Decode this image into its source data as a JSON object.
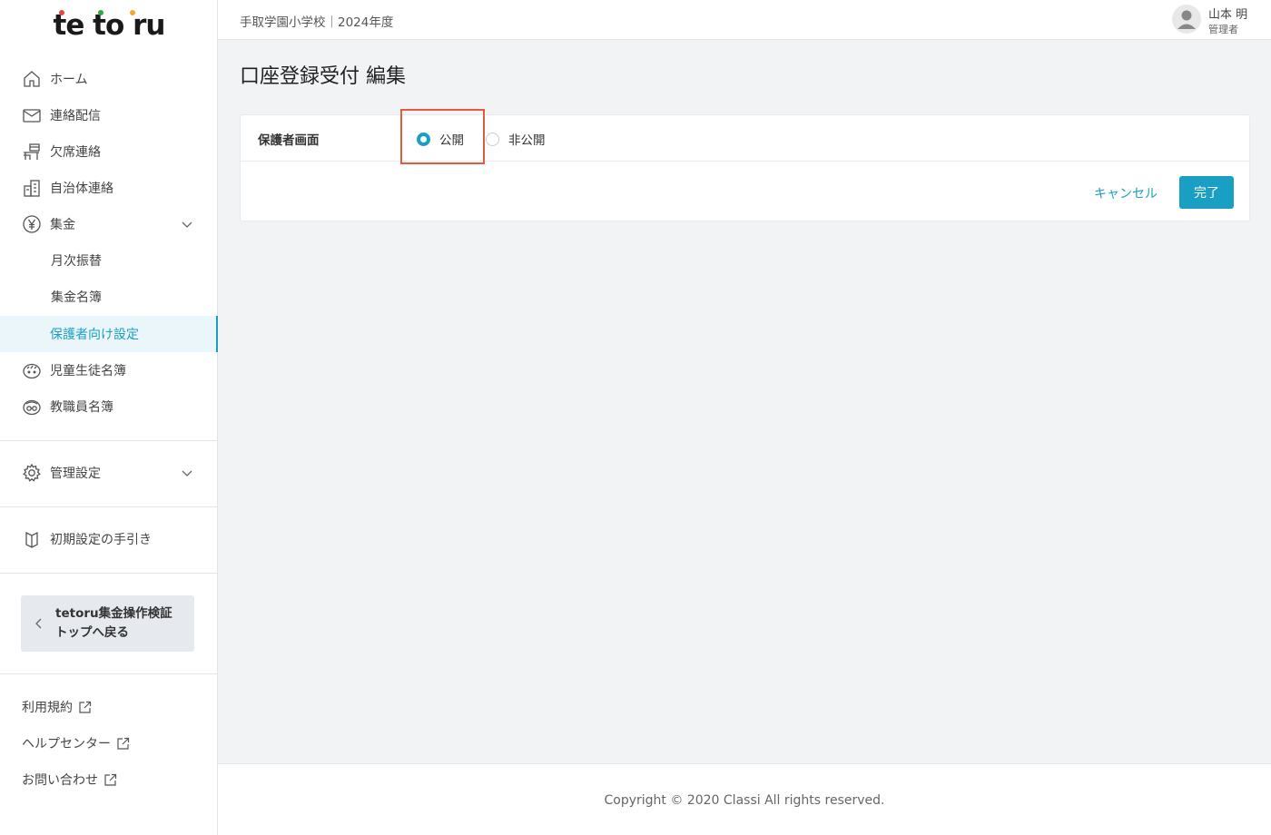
{
  "logo": {
    "text": "tetoru",
    "dot_colors": [
      "#e8453c",
      "#2eaa3b",
      "#f5a623"
    ]
  },
  "header": {
    "school": "手取学園小学校｜2024年度",
    "user_name": "山本 明",
    "user_role": "管理者"
  },
  "sidebar": {
    "items": [
      {
        "label": "ホーム",
        "icon": "home-icon"
      },
      {
        "label": "連絡配信",
        "icon": "mail-icon"
      },
      {
        "label": "欠席連絡",
        "icon": "desk-icon"
      },
      {
        "label": "自治体連絡",
        "icon": "building-icon"
      },
      {
        "label": "集金",
        "icon": "yen-icon"
      },
      {
        "label": "月次振替"
      },
      {
        "label": "集金名簿"
      },
      {
        "label": "保護者向け設定"
      },
      {
        "label": "児童生徒名簿",
        "icon": "child-face-icon"
      },
      {
        "label": "教職員名簿",
        "icon": "teacher-face-icon"
      },
      {
        "label": "管理設定",
        "icon": "gear-icon"
      },
      {
        "label": "初期設定の手引き",
        "icon": "book-icon"
      }
    ],
    "back_line1": "tetoru集金操作検証",
    "back_line2": "トップへ戻る",
    "footer_links": [
      "利用規約",
      "ヘルプセンター",
      "お問い合わせ"
    ]
  },
  "main": {
    "title": "口座登録受付 編集",
    "row_label": "保護者画面",
    "option_public": "公開",
    "option_private": "非公開",
    "selected": "公開",
    "cancel": "キャンセル",
    "done": "完了"
  },
  "colors": {
    "accent": "#1a9fc4",
    "highlight": "#e05c3c"
  },
  "footer": {
    "copyright": "Copyright © 2020 Classi All rights reserved."
  }
}
